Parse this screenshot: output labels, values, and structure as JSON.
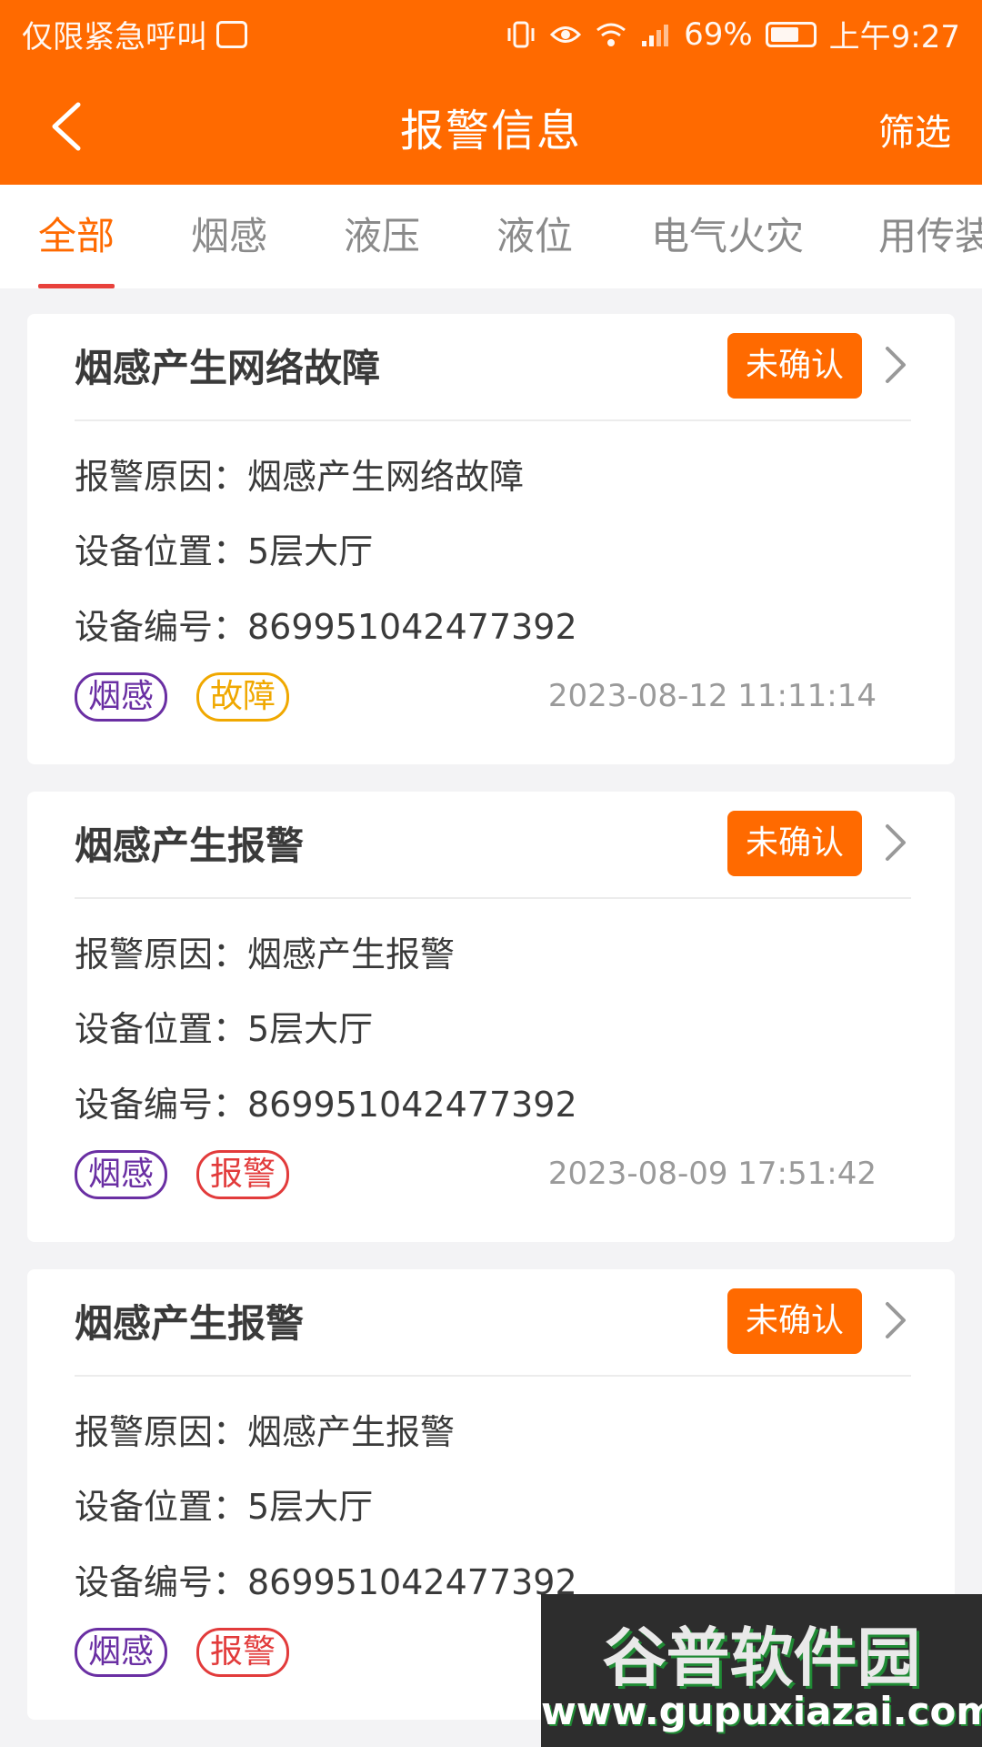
{
  "status_bar": {
    "carrier_text": "仅限紧急呼叫",
    "battery": "69%",
    "time": "上午9:27"
  },
  "header": {
    "title": "报警信息",
    "filter_label": "筛选"
  },
  "tabs": [
    {
      "label": "全部",
      "active": true
    },
    {
      "label": "烟感",
      "active": false
    },
    {
      "label": "液压",
      "active": false
    },
    {
      "label": "液位",
      "active": false
    },
    {
      "label": "电气火灾",
      "active": false
    },
    {
      "label": "用传装",
      "active": false
    }
  ],
  "alerts": [
    {
      "title": "烟感产生网络故障",
      "status": "未确认",
      "reason": "报警原因：烟感产生网络故障",
      "location": "设备位置：5层大厅",
      "device_no": "设备编号：869951042477392",
      "tag1": "烟感",
      "tag2": "故障",
      "time": "2023-08-12 11:11:14"
    },
    {
      "title": "烟感产生报警",
      "status": "未确认",
      "reason": "报警原因：烟感产生报警",
      "location": "设备位置：5层大厅",
      "device_no": "设备编号：869951042477392",
      "tag1": "烟感",
      "tag2": "报警",
      "time": "2023-08-09 17:51:42"
    },
    {
      "title": "烟感产生报警",
      "status": "未确认",
      "reason": "报警原因：烟感产生报警",
      "location": "设备位置：5层大厅",
      "device_no": "设备编号：869951042477392",
      "tag1": "烟感",
      "tag2": "报警",
      "time": ""
    }
  ],
  "watermark": {
    "logo_text": "谷普软件园",
    "url": "www.gupuxiazai.com"
  }
}
